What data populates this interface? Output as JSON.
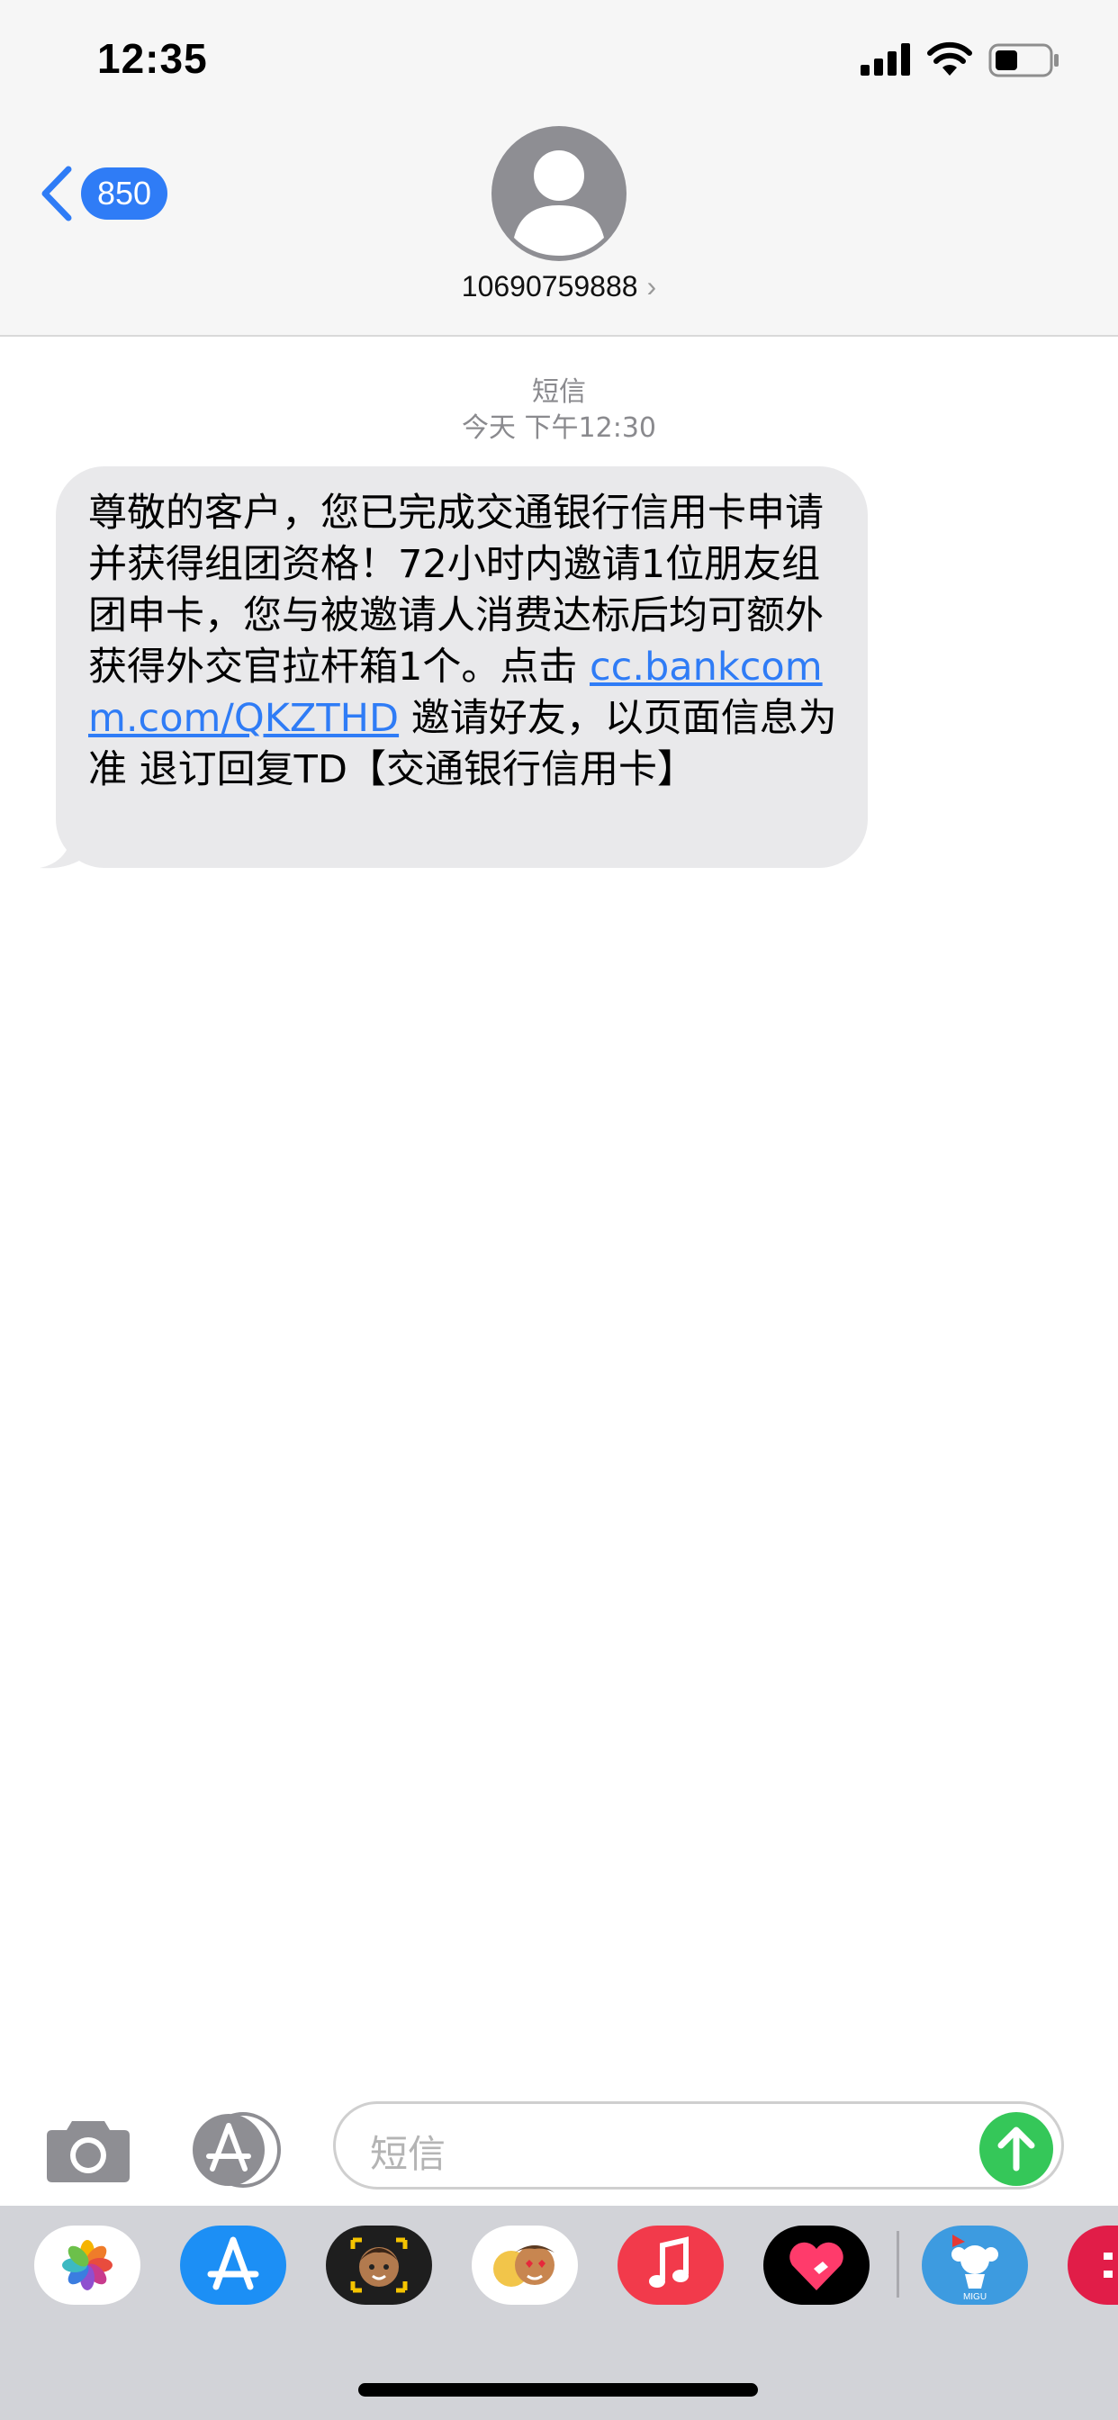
{
  "status_bar": {
    "time": "12:35"
  },
  "header": {
    "back_count": "850",
    "contact_number": "10690759888",
    "chevron": "›"
  },
  "conversation": {
    "message_type": "短信",
    "timestamp": "今天 下午12:30",
    "message": {
      "text_before": "尊敬的客户，您已完成交通银行信用卡申请并获得组团资格！72小时内邀请1位朋友组团申卡，您与被邀请人消费达标后均可额外获得外交官拉杆箱1个。点击 ",
      "link": "cc.bankcomm.com/QKZTHD",
      "text_after": " 邀请好友，以页面信息为准 退订回复TD【交通银行信用卡】"
    }
  },
  "compose": {
    "placeholder": "短信"
  },
  "app_tray": {
    "apps": [
      "photos-icon",
      "app-store-icon",
      "memoji-icon",
      "animoji-stickers-icon",
      "music-icon",
      "digital-touch-icon",
      "migu-icon",
      "partial-app-icon"
    ]
  },
  "colors": {
    "accent": "#2f7cf6",
    "send": "#35c759",
    "bubble": "#e9e9eb"
  }
}
